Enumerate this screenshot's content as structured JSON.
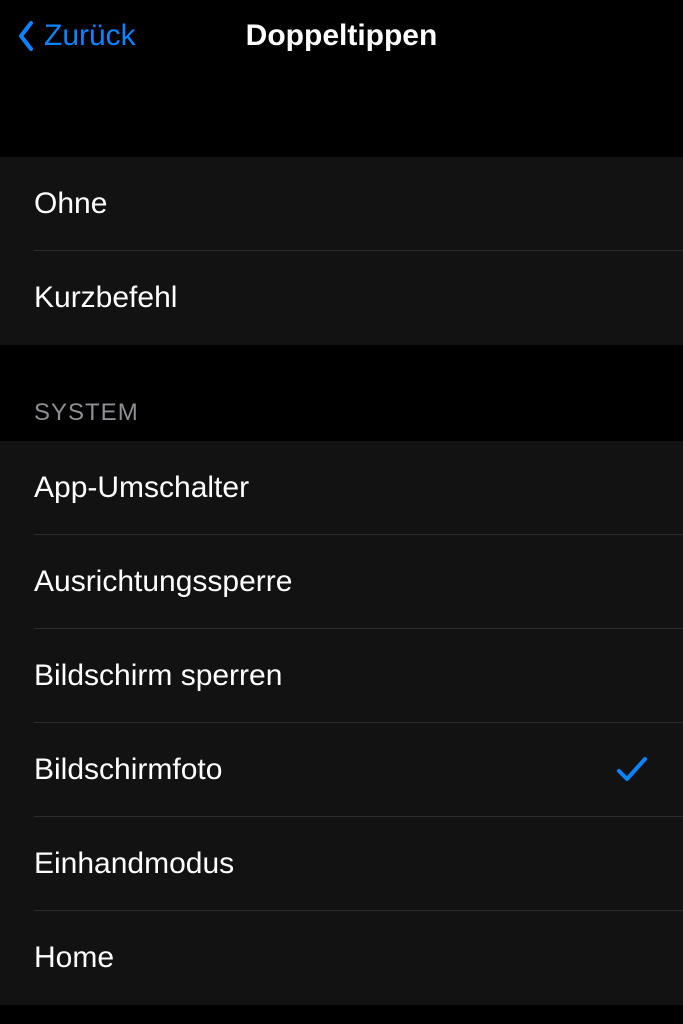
{
  "header": {
    "back_label": "Zurück",
    "title": "Doppeltippen"
  },
  "sections": {
    "top": {
      "items": [
        {
          "label": "Ohne",
          "selected": false
        },
        {
          "label": "Kurzbefehl",
          "selected": false
        }
      ]
    },
    "system": {
      "title": "SYSTEM",
      "items": [
        {
          "label": "App-Umschalter",
          "selected": false
        },
        {
          "label": "Ausrichtungssperre",
          "selected": false
        },
        {
          "label": "Bildschirm sperren",
          "selected": false
        },
        {
          "label": "Bildschirmfoto",
          "selected": true
        },
        {
          "label": "Einhandmodus",
          "selected": false
        },
        {
          "label": "Home",
          "selected": false
        }
      ]
    }
  }
}
